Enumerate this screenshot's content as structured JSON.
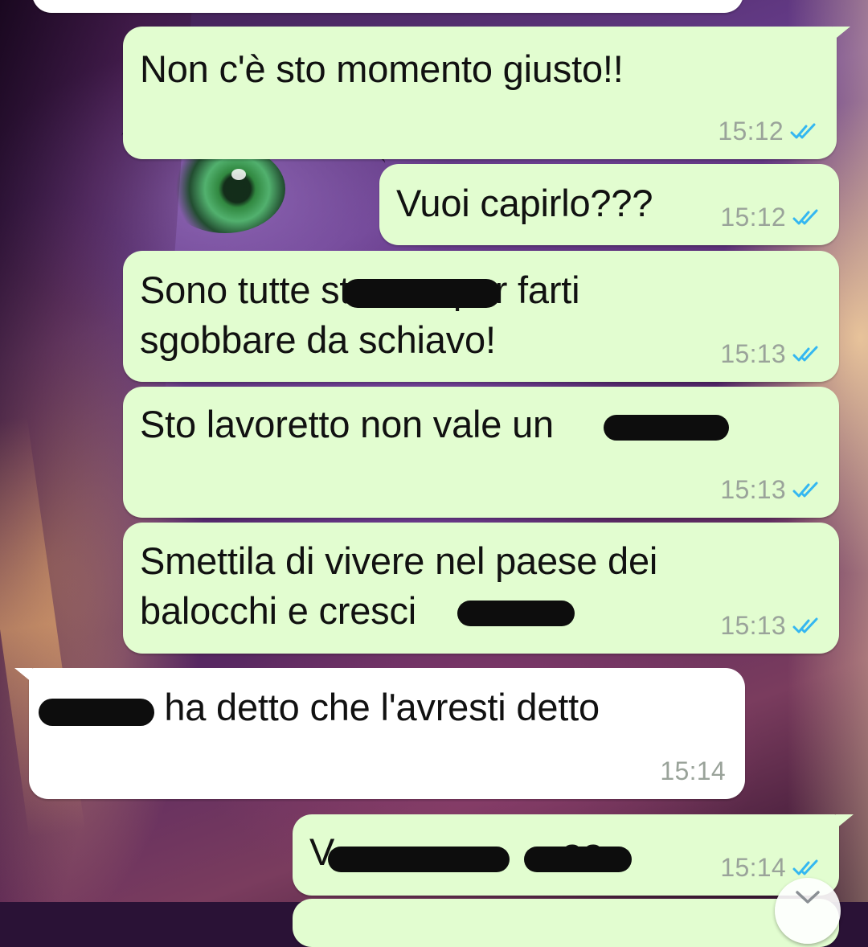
{
  "colors": {
    "outgoing_bubble": "#e2fdd0",
    "incoming_bubble": "#ffffff",
    "read_ticks": "#34b7f1",
    "timestamp": "#9aa39a"
  },
  "messages": [
    {
      "direction": "out",
      "text": "Non c'è sto momento giusto!!",
      "time": "15:12",
      "status": "read-ticks-icon"
    },
    {
      "direction": "out",
      "text": "Vuoi capirlo???",
      "time": "15:12",
      "status": "read-ticks-icon"
    },
    {
      "direction": "out",
      "text": "Sono tutte st          per farti\nsgobbare da schiavo!",
      "time": "15:13",
      "status": "read-ticks-icon"
    },
    {
      "direction": "out",
      "text": "Sto lavoretto non vale un",
      "time": "15:13",
      "status": "read-ticks-icon"
    },
    {
      "direction": "out",
      "text": "Smettila di vivere nel paese dei\nbalocchi e cresci",
      "time": "15:13",
      "status": "read-ticks-icon"
    },
    {
      "direction": "in",
      "text": "            ha detto che l'avresti detto",
      "time": "15:14"
    },
    {
      "direction": "out",
      "text": "V                      aa",
      "time": "15:14",
      "status": "read-ticks-icon"
    }
  ],
  "scroll_down_icon": "chevron-down-icon"
}
